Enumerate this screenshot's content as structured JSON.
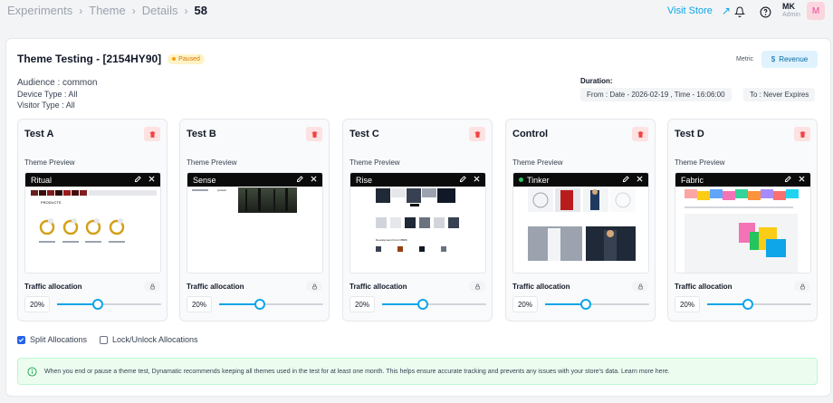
{
  "breadcrumb": {
    "items": [
      "Experiments",
      "Theme",
      "Details"
    ],
    "current": "58"
  },
  "header": {
    "visit_store": "Visit Store",
    "user_name": "MK",
    "user_role": "Admin",
    "avatar_initial": "M"
  },
  "experiment": {
    "title": "Theme Testing - [2154HY90]",
    "status": "Paused",
    "audience": "Audience : common",
    "device_type": "Device Type : All",
    "visitor_type": "Visitor Type : All",
    "metric_label": "Metric",
    "metric_value": "Revenue",
    "duration_label": "Duration:",
    "duration_from": "From : Date - 2026-02-19 , Time - 16:06:00",
    "duration_to": "To : Never Expires"
  },
  "cards": [
    {
      "title": "Test A",
      "preview_label": "Theme Preview",
      "theme": "Ritual",
      "active": false,
      "traffic_label": "Traffic allocation",
      "allocation_text": "20%",
      "allocation": 0.2
    },
    {
      "title": "Test B",
      "preview_label": "Theme Preview",
      "theme": "Sense",
      "active": false,
      "traffic_label": "Traffic allocation",
      "allocation_text": "20%",
      "allocation": 0.2
    },
    {
      "title": "Test C",
      "preview_label": "Theme Preview",
      "theme": "Rise",
      "active": false,
      "traffic_label": "Traffic allocation",
      "allocation_text": "20%",
      "allocation": 0.2
    },
    {
      "title": "Control",
      "preview_label": "Theme Preview",
      "theme": "Tinker",
      "active": true,
      "traffic_label": "Traffic allocation",
      "allocation_text": "20%",
      "allocation": 0.2
    },
    {
      "title": "Test D",
      "preview_label": "Theme Preview",
      "theme": "Fabric",
      "active": false,
      "traffic_label": "Traffic allocation",
      "allocation_text": "20%",
      "allocation": 0.2
    }
  ],
  "options": {
    "split_label": "Split Allocations",
    "split_checked": true,
    "lock_label": "Lock/Unlock Allocations",
    "lock_checked": false
  },
  "notice": "When you end or pause a theme test, Dynamatic recommends keeping all themes used in the test for at least one month. This helps ensure accurate tracking and prevents any issues with your store's data. Learn more here.",
  "colors": {
    "accent": "#0ea5e9",
    "paused": "#f59e0b",
    "delete": "#ef4444",
    "active_dot": "#22c55e"
  }
}
